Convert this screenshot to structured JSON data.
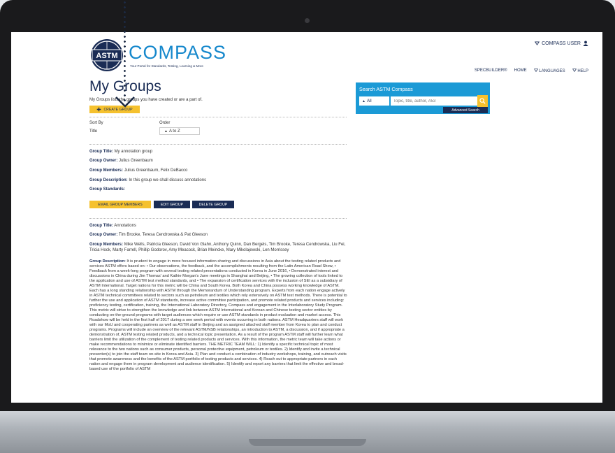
{
  "header": {
    "logo_mark": "ASTM",
    "logo_name": "COMPASS",
    "logo_tagline": "Your Portal for Standards, Testing, Learning & More",
    "user_menu": "COMPASS USER",
    "nav": [
      "SPECBUILDER®",
      "HOME",
      "LANGUAGES",
      "HELP"
    ]
  },
  "search": {
    "title": "Search ASTM Compass",
    "scope": "All",
    "placeholder": "Topic, title, author, A53",
    "advanced": "Advanced Search"
  },
  "page": {
    "title": "My Groups",
    "subtitle": "My Groups lists the groups you have created or are a part of.",
    "create_button": "CREATE GROUP"
  },
  "sort": {
    "sort_by_label": "Sort By",
    "sort_by_value": "Title",
    "order_label": "Order",
    "order_value": "A to Z"
  },
  "labels": {
    "group_title": "Group Title:",
    "group_owner": "Group Owner:",
    "group_members": "Group Members:",
    "group_description": "Group Description:",
    "group_standards": "Group Standards:"
  },
  "groups": [
    {
      "title": "My annotation group",
      "owner": "Julius Greenbaum",
      "members": "Julius Greenbaum, Felix DeBacco",
      "description": "In this group we shall discuss annotations",
      "standards": "",
      "buttons": {
        "email": "EMAIL GROUP MEMBERS",
        "edit": "EDIT GROUP",
        "delete": "DELETE GROUP"
      }
    },
    {
      "title": "Annotations",
      "owner": "Tim Brooke, Teresa Cendrowska & Pat Gleeson",
      "members": "Mike Wells, Patricia Gleeson, David Von Glahn, Anthony Quinn, Dan Bergels, Tim Brooke, Teresa Cendrowska, Liu Fei, Tricia Hock, Marty Farrell, Phillip Godorov, Amy Meacock, Brian Meincke, Mary Mikolajewski, Len Morrissey",
      "description": "It is prudent to engage in more focused information sharing and discussions in Asia about the testing related products and services ASTM offers based on: • Our observations, the feedback, and the accomplishments resulting from the Latin American Road Show, • Feedback from a week-long program with several testing related presentations conducted in Korea in June 2016, • Demonstrated interest and discussions in China during Jim Thomas' and Kathie Morgan's June meetings in Shanghai and Beijing, • The growing collection of tools linked to the application and use of ASTM test method standards, and • The expansion of certification services with the inclusion of SEI as a subsidiary of ASTM International. Target nations for this metric will be China and South Korea. Both Korea and China possess working knowledge of ASTM. Each has a long standing relationship with ASTM through the Memorandum of Understanding program. Experts from each nation engage actively in ASTM technical committees related to sectors such as petroleum and textiles which rely extensively on ASTM test methods. There is potential to further the use and application of ASTM standards, increase active committee participation, and promote related products and services including: proficiency testing, certification, training, the International Laboratory Directory, Compass and engagement in the Interlaboratory Study Program. This metric will strive to strengthen the knowledge and link between ASTM International and Korean and Chinese testing sector entities by conducting on-the-ground programs with target audiences which require or use ASTM standards in product evaluation and market access. This Roadshow will be held in the first half of 2017 during a one week period with events occurring in both nations. ASTM Headquarters staff will work with our MoU and cooperating partners as well as ASTM staff in Beijing and an assigned attached staff member from Korea to plan and conduct programs. Programs will include an overview of the relevant ASTM/NSB relationships, an introduction to ASTM, a discussion, and if appropriate a demonstration of, ASTM testing related products, and a technical topic presentation. As a result of the program ASTM staff will further learn what barriers limit the utilization of the complement of testing related products and services. With this information, the metric team will take actions or make recommendations to minimize or eliminate identified barriers.   THE METRIC TEAM WILL: 1) Identify a specific technical topic of most relevance to the two nations such as consumer products, personal protective equipment, petroleum or textiles. 2) Identify and invite a technical presenter(s) to join the staff team on-site in Korea and Asia. 3) Plan and conduct a combination of industry workshops, training, and outreach visits that promote awareness and the benefits of the ASTM portfolio of testing products and services. 4) Reach out to appropriate partners in each nation and engage them in program development and audience identification. 5) Identify and report any barriers that limit the effective and broad-based use of the portfolio of ASTM"
    }
  ]
}
